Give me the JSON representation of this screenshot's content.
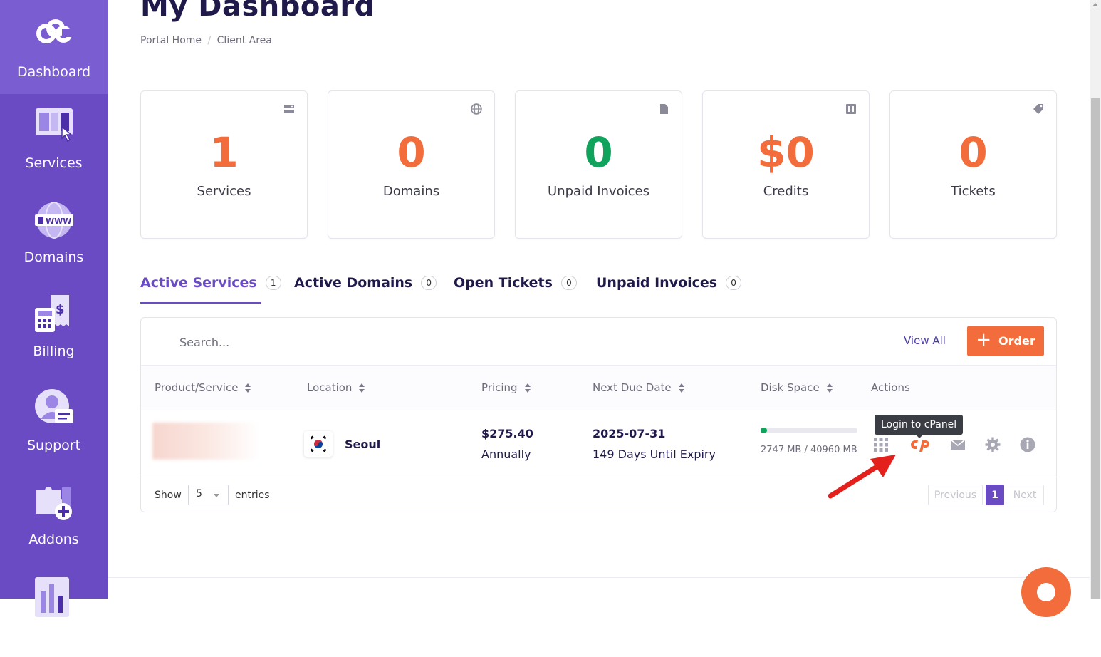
{
  "sidebar": {
    "items": [
      {
        "label": "Dashboard",
        "icon": "logo-icon"
      },
      {
        "label": "Services",
        "icon": "services-icon"
      },
      {
        "label": "Domains",
        "icon": "www-globe-icon"
      },
      {
        "label": "Billing",
        "icon": "billing-calculator-icon"
      },
      {
        "label": "Support",
        "icon": "support-user-icon"
      },
      {
        "label": "Addons",
        "icon": "puzzle-addon-icon"
      },
      {
        "label": "",
        "icon": "chart-icon"
      }
    ]
  },
  "header": {
    "title": "My Dashboard",
    "breadcrumb": [
      "Portal Home",
      "/",
      "Client Area"
    ]
  },
  "stats": [
    {
      "value": "1",
      "label": "Services",
      "color": "#f26d3b",
      "icon": "server-icon"
    },
    {
      "value": "0",
      "label": "Domains",
      "color": "#f26d3b",
      "icon": "globe-icon"
    },
    {
      "value": "0",
      "label": "Unpaid Invoices",
      "color": "#10a35c",
      "icon": "document-icon"
    },
    {
      "value": "$0",
      "label": "Credits",
      "color": "#f26d3b",
      "icon": "credit-icon"
    },
    {
      "value": "0",
      "label": "Tickets",
      "color": "#f26d3b",
      "icon": "tag-icon"
    }
  ],
  "tabs": [
    {
      "label": "Active Services",
      "count": "1"
    },
    {
      "label": "Active Domains",
      "count": "0"
    },
    {
      "label": "Open Tickets",
      "count": "0"
    },
    {
      "label": "Unpaid Invoices",
      "count": "0"
    }
  ],
  "panel": {
    "search_placeholder": "Search...",
    "view_all": "View All",
    "order_label": "Order",
    "order_plus": "+"
  },
  "table": {
    "columns": [
      "Product/Service",
      "Location",
      "Pricing",
      "Next Due Date",
      "Disk Space",
      "Actions"
    ],
    "rows": [
      {
        "location": "Seoul",
        "price": "$275.40",
        "cycle": "Annually",
        "due_date": "2025-07-31",
        "expiry": "149 Days Until Expiry",
        "disk_text": "2747 MB / 40960 MB",
        "disk_fraction": 0.067
      }
    ],
    "tooltip": "Login to cPanel"
  },
  "footer": {
    "show": "Show",
    "entries_value": "5",
    "entries": "entries",
    "prev": "Previous",
    "page": "1",
    "next": "Next"
  },
  "colors": {
    "sidebar": "#6a4bc4",
    "accent": "#f26d3b",
    "green": "#10a35c",
    "primary": "#6a4bc4"
  }
}
